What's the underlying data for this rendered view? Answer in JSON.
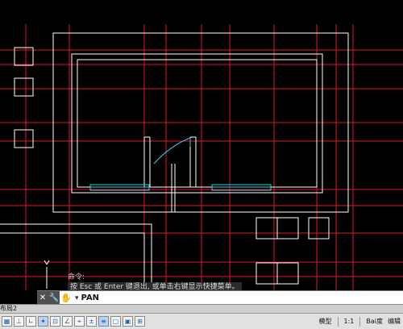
{
  "colors": {
    "background": "#000000",
    "grid_lines": "#e0152c",
    "walls": "#ffffff",
    "cyan_elements": "#2fd4e2"
  },
  "command_history": {
    "line1": "命令:",
    "line2": "按 Esc 或 Enter 键退出, 或单击右键显示快捷菜单。"
  },
  "command_line": {
    "close_icon": "close-icon",
    "settings_icon": "wrench-icon",
    "prompt_icon": "hand-pan-icon",
    "caret": "▾",
    "current_command": "PAN"
  },
  "layout_tab": {
    "label": "布局2"
  },
  "status_bar": {
    "model_label": "模型",
    "scale_label": "1:1",
    "edit_label": "编辑",
    "watermark": "Bai度"
  }
}
